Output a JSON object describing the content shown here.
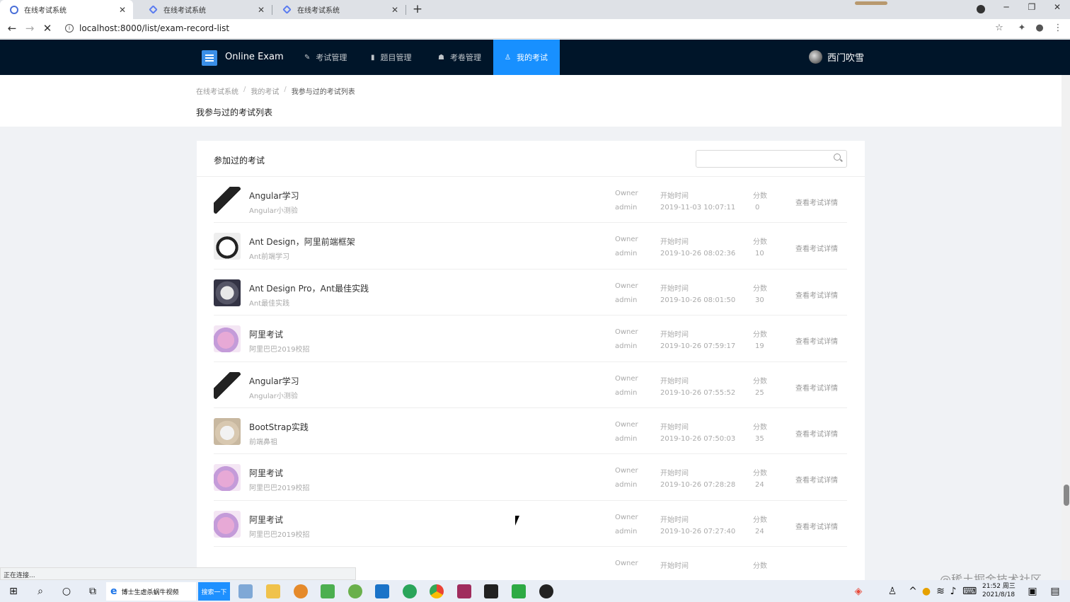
{
  "browser": {
    "tabs": [
      {
        "title": "在线考试系统",
        "active": true
      },
      {
        "title": "在线考试系统",
        "active": false
      },
      {
        "title": "在线考试系统",
        "active": false
      }
    ],
    "url": "localhost:8000/list/exam-record-list",
    "status_text": "正在连接..."
  },
  "header": {
    "logo_text": "Online Exam",
    "nav": [
      {
        "label": "考试管理",
        "icon": "edit-icon",
        "active": false
      },
      {
        "label": "题目管理",
        "icon": "file-icon",
        "active": false
      },
      {
        "label": "考卷管理",
        "icon": "paper-icon",
        "active": false
      },
      {
        "label": "我的考试",
        "icon": "user-icon",
        "active": true
      }
    ],
    "username": "西门吹雪"
  },
  "page": {
    "breadcrumb": [
      "在线考试系统",
      "我的考试",
      "我参与过的考试列表"
    ],
    "title": "我参与过的考试列表"
  },
  "card": {
    "title": "参加过的考试",
    "search_placeholder": "",
    "labels": {
      "owner": "Owner",
      "start_time": "开始时间",
      "score": "分数",
      "detail_link": "查看考试详情"
    },
    "records": [
      {
        "name": "Angular学习",
        "desc": "Angular小测验",
        "owner": "admin",
        "start": "2019-11-03 10:07:11",
        "score": "0",
        "avatar": "cat-bw"
      },
      {
        "name": "Ant Design，阿里前端框架",
        "desc": "Ant前端学习",
        "owner": "admin",
        "start": "2019-10-26 08:02:36",
        "score": "10",
        "avatar": "panda"
      },
      {
        "name": "Ant Design Pro，Ant最佳实践",
        "desc": "Ant最佳实践",
        "owner": "admin",
        "start": "2019-10-26 08:01:50",
        "score": "30",
        "avatar": "dogs"
      },
      {
        "name": "阿里考试",
        "desc": "阿里巴巴2019校招",
        "owner": "admin",
        "start": "2019-10-26 07:59:17",
        "score": "19",
        "avatar": "bird"
      },
      {
        "name": "Angular学习",
        "desc": "Angular小测验",
        "owner": "admin",
        "start": "2019-10-26 07:55:52",
        "score": "25",
        "avatar": "cat-bw"
      },
      {
        "name": "BootStrap实践",
        "desc": "前端鼻祖",
        "owner": "admin",
        "start": "2019-10-26 07:50:03",
        "score": "35",
        "avatar": "kitten"
      },
      {
        "name": "阿里考试",
        "desc": "阿里巴巴2019校招",
        "owner": "admin",
        "start": "2019-10-26 07:28:28",
        "score": "24",
        "avatar": "bird"
      },
      {
        "name": "阿里考试",
        "desc": "阿里巴巴2019校招",
        "owner": "admin",
        "start": "2019-10-26 07:27:40",
        "score": "24",
        "avatar": "bird"
      },
      {
        "name": "",
        "desc": "",
        "owner": "",
        "start": "",
        "score": "",
        "avatar": "blank"
      }
    ]
  },
  "taskbar": {
    "edge_label": "博士生虐杀蜗牛视频",
    "search_button": "搜索一下",
    "time": "21:52 周三",
    "date": "2021/8/18"
  },
  "watermark": "@稀土掘金技术社区"
}
